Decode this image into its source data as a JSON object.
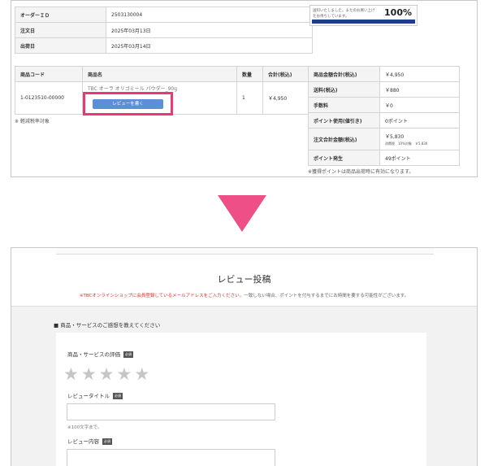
{
  "order": {
    "rows": [
      {
        "label": "オーダーＩＤ",
        "value": "2503130004"
      },
      {
        "label": "注文日",
        "value": "2025年03月13日"
      },
      {
        "label": "出荷日",
        "value": "2025年03月14日"
      }
    ]
  },
  "shipping_progress": {
    "message": "送料いたしました。またのお買い上げをお待ちしています。",
    "percent_label": "100%",
    "fraction": 1.0
  },
  "items": {
    "headers": [
      "商品コード",
      "商品名",
      "数量",
      "合計(税込)"
    ],
    "rows": [
      {
        "code": "1-0123510-00000",
        "name": "TBC オーラ オリゴミール パウダー_90g",
        "qty": "1",
        "total": "￥4,950"
      }
    ],
    "review_button": "レビューを書く",
    "tax_note": "※ 軽減税率対象"
  },
  "totals": {
    "rows": [
      {
        "label": "商品金額合計(税込)",
        "value": "￥4,950"
      },
      {
        "label": "送料(税込)",
        "value": "￥880"
      },
      {
        "label": "手数料",
        "value": "￥0"
      },
      {
        "label": "ポイント使用(値引き)",
        "value": "0ポイント"
      },
      {
        "label": "注文合計金額(税込)",
        "value": "￥5,830",
        "sub": "消費税　10%対象　￥5,830"
      },
      {
        "label": "ポイント発生",
        "value": "49ポイント"
      }
    ],
    "points_note": "※獲得ポイントは商品出荷時に有効になります。"
  },
  "review_form": {
    "title": "レビュー投稿",
    "notice_red": "※TBCオンラインショップに会員登録しているメールアドレスをご入力ください。",
    "notice_rest": "一致しない場合、ポイントを付与するまでにお時間を要する可能性がございます。",
    "section_heading": "■ 商品・サービスのご感想を教えてください",
    "rating_label": "商品・サービスの評価",
    "required_badge": "必須",
    "stars": "★★★★★",
    "review_title_label": "レビュータイトル",
    "title_hint": "※100文字まで。",
    "review_body_label": "レビュー内容"
  },
  "colors": {
    "highlight": "#e83a72",
    "button": "#5b8fd6",
    "arrow": "#ef4f87",
    "progress_fill": "#1e3e8c",
    "notice_red": "#e0322b"
  }
}
